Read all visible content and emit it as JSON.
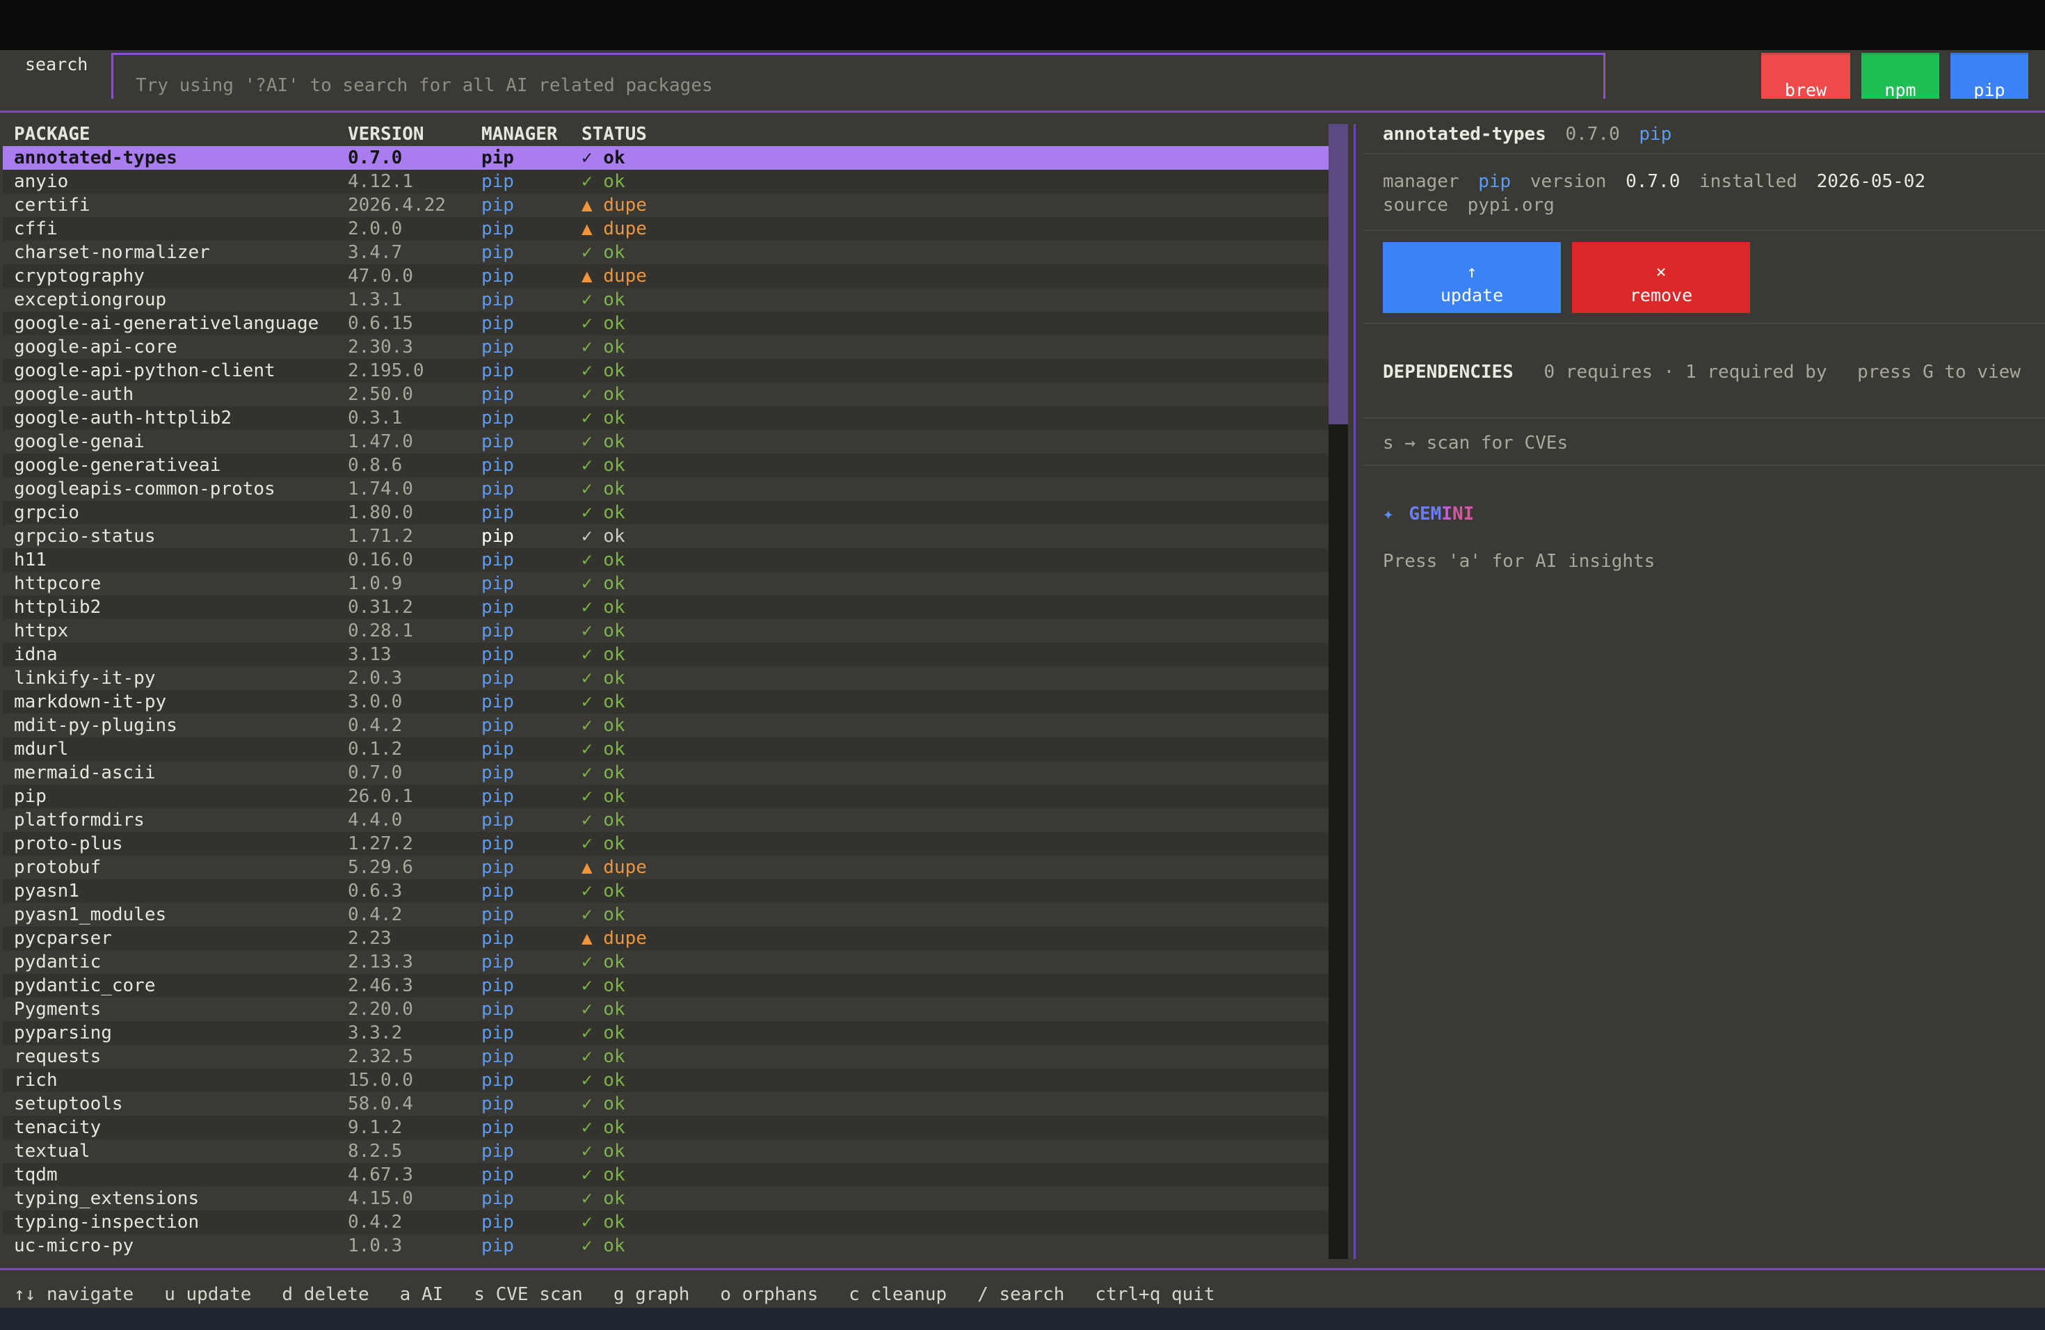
{
  "search": {
    "label": "search",
    "placeholder": "Try using '?AI' to search for all AI related packages",
    "value": ""
  },
  "managers": [
    {
      "label": "brew",
      "color": "#ee4a4a"
    },
    {
      "label": "npm",
      "color": "#1fbf55"
    },
    {
      "label": "pip",
      "color": "#3a82f6"
    }
  ],
  "table": {
    "headers": {
      "package": "PACKAGE",
      "version": "VERSION",
      "manager": "MANAGER",
      "status": "STATUS"
    },
    "rows": [
      {
        "package": "annotated-types",
        "version": "0.7.0",
        "manager": "pip",
        "status": "✓ ok"
      },
      {
        "package": "anyio",
        "version": "4.12.1",
        "manager": "pip",
        "status": "✓ ok"
      },
      {
        "package": "certifi",
        "version": "2026.4.22",
        "manager": "pip",
        "status": "▲ dupe"
      },
      {
        "package": "cffi",
        "version": "2.0.0",
        "manager": "pip",
        "status": "▲ dupe"
      },
      {
        "package": "charset-normalizer",
        "version": "3.4.7",
        "manager": "pip",
        "status": "✓ ok"
      },
      {
        "package": "cryptography",
        "version": "47.0.0",
        "manager": "pip",
        "status": "▲ dupe"
      },
      {
        "package": "exceptiongroup",
        "version": "1.3.1",
        "manager": "pip",
        "status": "✓ ok"
      },
      {
        "package": "google-ai-generativelanguage",
        "version": "0.6.15",
        "manager": "pip",
        "status": "✓ ok"
      },
      {
        "package": "google-api-core",
        "version": "2.30.3",
        "manager": "pip",
        "status": "✓ ok"
      },
      {
        "package": "google-api-python-client",
        "version": "2.195.0",
        "manager": "pip",
        "status": "✓ ok"
      },
      {
        "package": "google-auth",
        "version": "2.50.0",
        "manager": "pip",
        "status": "✓ ok"
      },
      {
        "package": "google-auth-httplib2",
        "version": "0.3.1",
        "manager": "pip",
        "status": "✓ ok"
      },
      {
        "package": "google-genai",
        "version": "1.47.0",
        "manager": "pip",
        "status": "✓ ok"
      },
      {
        "package": "google-generativeai",
        "version": "0.8.6",
        "manager": "pip",
        "status": "✓ ok"
      },
      {
        "package": "googleapis-common-protos",
        "version": "1.74.0",
        "manager": "pip",
        "status": "✓ ok"
      },
      {
        "package": "grpcio",
        "version": "1.80.0",
        "manager": "pip",
        "status": "✓ ok"
      },
      {
        "package": "grpcio-status",
        "version": "1.71.2",
        "manager": "pip",
        "status": "✓ ok"
      },
      {
        "package": "h11",
        "version": "0.16.0",
        "manager": "pip",
        "status": "✓ ok"
      },
      {
        "package": "httpcore",
        "version": "1.0.9",
        "manager": "pip",
        "status": "✓ ok"
      },
      {
        "package": "httplib2",
        "version": "0.31.2",
        "manager": "pip",
        "status": "✓ ok"
      },
      {
        "package": "httpx",
        "version": "0.28.1",
        "manager": "pip",
        "status": "✓ ok"
      },
      {
        "package": "idna",
        "version": "3.13",
        "manager": "pip",
        "status": "✓ ok"
      },
      {
        "package": "linkify-it-py",
        "version": "2.0.3",
        "manager": "pip",
        "status": "✓ ok"
      },
      {
        "package": "markdown-it-py",
        "version": "3.0.0",
        "manager": "pip",
        "status": "✓ ok"
      },
      {
        "package": "mdit-py-plugins",
        "version": "0.4.2",
        "manager": "pip",
        "status": "✓ ok"
      },
      {
        "package": "mdurl",
        "version": "0.1.2",
        "manager": "pip",
        "status": "✓ ok"
      },
      {
        "package": "mermaid-ascii",
        "version": "0.7.0",
        "manager": "pip",
        "status": "✓ ok"
      },
      {
        "package": "pip",
        "version": "26.0.1",
        "manager": "pip",
        "status": "✓ ok"
      },
      {
        "package": "platformdirs",
        "version": "4.4.0",
        "manager": "pip",
        "status": "✓ ok"
      },
      {
        "package": "proto-plus",
        "version": "1.27.2",
        "manager": "pip",
        "status": "✓ ok"
      },
      {
        "package": "protobuf",
        "version": "5.29.6",
        "manager": "pip",
        "status": "▲ dupe"
      },
      {
        "package": "pyasn1",
        "version": "0.6.3",
        "manager": "pip",
        "status": "✓ ok"
      },
      {
        "package": "pyasn1_modules",
        "version": "0.4.2",
        "manager": "pip",
        "status": "✓ ok"
      },
      {
        "package": "pycparser",
        "version": "2.23",
        "manager": "pip",
        "status": "▲ dupe"
      },
      {
        "package": "pydantic",
        "version": "2.13.3",
        "manager": "pip",
        "status": "✓ ok"
      },
      {
        "package": "pydantic_core",
        "version": "2.46.3",
        "manager": "pip",
        "status": "✓ ok"
      },
      {
        "package": "Pygments",
        "version": "2.20.0",
        "manager": "pip",
        "status": "✓ ok"
      },
      {
        "package": "pyparsing",
        "version": "3.3.2",
        "manager": "pip",
        "status": "✓ ok"
      },
      {
        "package": "requests",
        "version": "2.32.5",
        "manager": "pip",
        "status": "✓ ok"
      },
      {
        "package": "rich",
        "version": "15.0.0",
        "manager": "pip",
        "status": "✓ ok"
      },
      {
        "package": "setuptools",
        "version": "58.0.4",
        "manager": "pip",
        "status": "✓ ok"
      },
      {
        "package": "tenacity",
        "version": "9.1.2",
        "manager": "pip",
        "status": "✓ ok"
      },
      {
        "package": "textual",
        "version": "8.2.5",
        "manager": "pip",
        "status": "✓ ok"
      },
      {
        "package": "tqdm",
        "version": "4.67.3",
        "manager": "pip",
        "status": "✓ ok"
      },
      {
        "package": "typing_extensions",
        "version": "4.15.0",
        "manager": "pip",
        "status": "✓ ok"
      },
      {
        "package": "typing-inspection",
        "version": "0.4.2",
        "manager": "pip",
        "status": "✓ ok"
      },
      {
        "package": "uc-micro-py",
        "version": "1.0.3",
        "manager": "pip",
        "status": "✓ ok"
      }
    ],
    "selected_index": 0,
    "plain_index": 16
  },
  "detail": {
    "name": "annotated-types",
    "version": "0.7.0",
    "manager": "pip",
    "manager_label": "manager",
    "version_label": "version",
    "installed_label": "installed",
    "installed": "2026-05-02",
    "source_label": "source",
    "source": "pypi.org",
    "update_icon": "↑",
    "update_label": "update",
    "remove_icon": "×",
    "remove_label": "remove",
    "dependencies_title": "DEPENDENCIES",
    "dependencies_summary": "0 requires · 1 required by",
    "dependencies_hint": "press G to view",
    "cve_hint": "s → scan for CVEs",
    "gemini_star": "✦",
    "gemini_a": "GEM",
    "gemini_b": "I",
    "gemini_c": "NI",
    "ai_hint": "Press 'a' for AI insights"
  },
  "footer": [
    "↑↓ navigate",
    "u update",
    "d delete",
    "a AI",
    "s CVE scan",
    "g graph",
    "o orphans",
    "c cleanup",
    "/ search",
    "ctrl+q quit"
  ]
}
